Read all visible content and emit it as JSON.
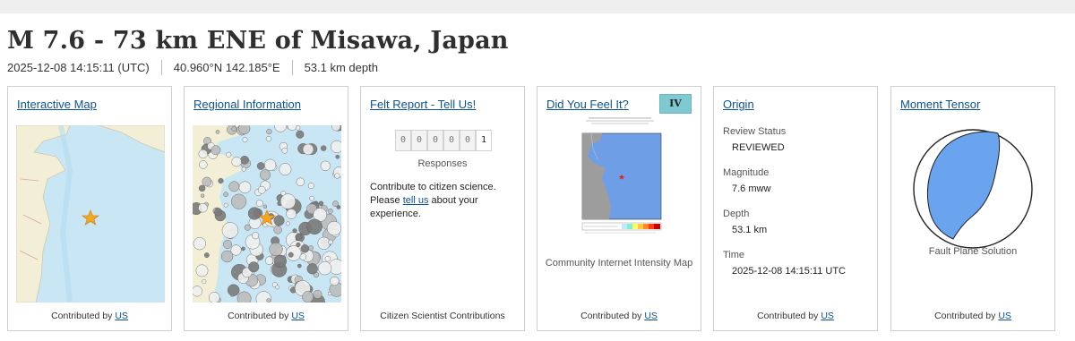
{
  "event": {
    "title": "M 7.6 - 73 km ENE of Misawa, Japan",
    "time": "2025-12-08 14:15:11 (UTC)",
    "coords": "40.960°N 142.185°E",
    "depth": "53.1 km depth"
  },
  "cards": {
    "interactive_map": {
      "title": "Interactive Map",
      "footer_prefix": "Contributed by",
      "footer_link": "US"
    },
    "regional": {
      "title": "Regional Information",
      "footer_prefix": "Contributed by",
      "footer_link": "US"
    },
    "felt": {
      "title": "Felt Report - Tell Us!",
      "digits": [
        "0",
        "0",
        "0",
        "0",
        "0",
        "1"
      ],
      "responses_label": "Responses",
      "text_before": "Contribute to citizen science. Please",
      "link": "tell us",
      "text_after": "about your experience.",
      "footer": "Citizen Scientist Contributions"
    },
    "dyfi": {
      "title": "Did You Feel It?",
      "badge": "IV",
      "caption": "Community Internet Intensity Map",
      "footer_prefix": "Contributed by",
      "footer_link": "US"
    },
    "origin": {
      "title": "Origin",
      "review_label": "Review Status",
      "review_value": "REVIEWED",
      "mag_label": "Magnitude",
      "mag_value": "7.6 mww",
      "depth_label": "Depth",
      "depth_value": "53.1 km",
      "time_label": "Time",
      "time_value": "2025-12-08 14:15:11 UTC",
      "footer_prefix": "Contributed by",
      "footer_link": "US"
    },
    "moment": {
      "title": "Moment Tensor",
      "caption": "Fault Plane Solution",
      "footer_prefix": "Contributed by",
      "footer_link": "US"
    }
  },
  "colors": {
    "link": "#0b5394",
    "ocean": "#c9e6f4",
    "land": "#f3efd6",
    "badge": "#7fcad2",
    "beachball": "#6aa3ee"
  }
}
